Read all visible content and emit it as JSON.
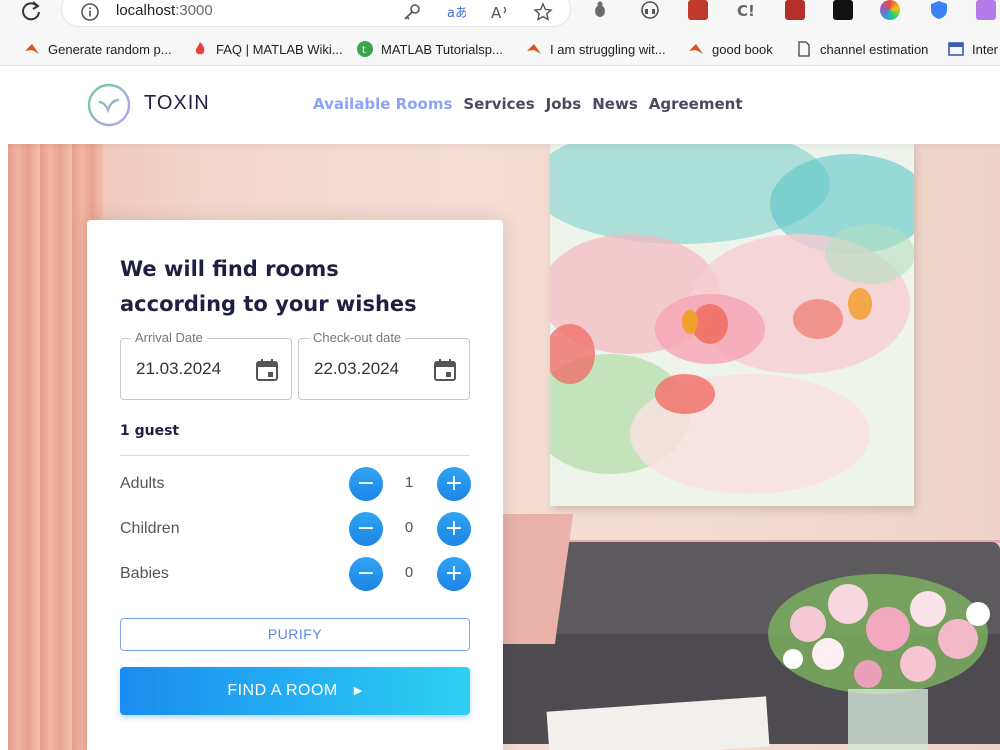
{
  "browser": {
    "url_host": "localhost",
    "url_port": ":3000",
    "bookmarks": [
      {
        "label": "Generate random p..."
      },
      {
        "label": "FAQ | MATLAB Wiki..."
      },
      {
        "label": "MATLAB  Tutorialsp..."
      },
      {
        "label": "I am struggling wit..."
      },
      {
        "label": "good book"
      },
      {
        "label": "channel estimation"
      },
      {
        "label": "Inter"
      }
    ]
  },
  "site": {
    "brand": "TOXIN",
    "nav": [
      {
        "label": "Available Rooms",
        "active": true
      },
      {
        "label": "Services",
        "active": false
      },
      {
        "label": "Jobs",
        "active": false
      },
      {
        "label": "News",
        "active": false
      },
      {
        "label": "Agreement",
        "active": false
      }
    ],
    "accent": "#8ba4f9",
    "dark_text": "#1f2041"
  },
  "booking": {
    "title": "We will find rooms according to your wishes",
    "arrival": {
      "label": "Arrival Date",
      "value": "21.03.2024"
    },
    "checkout": {
      "label": "Check-out date",
      "value": "22.03.2024"
    },
    "guests_summary": "1 guest",
    "guests": [
      {
        "name": "Adults",
        "count": "1",
        "minus": "−",
        "plus": "+"
      },
      {
        "name": "Children",
        "count": "0",
        "minus": "−",
        "plus": "+"
      },
      {
        "name": "Babies",
        "count": "0",
        "minus": "−",
        "plus": "+"
      }
    ],
    "purify_label": "PURIFY",
    "find_label": "FIND A ROOM",
    "find_arrow": "▶"
  },
  "icons": [
    "reload-icon",
    "info-icon",
    "key-icon",
    "translate-icon",
    "read-aloud-icon",
    "star-icon",
    "calendar-icon"
  ]
}
